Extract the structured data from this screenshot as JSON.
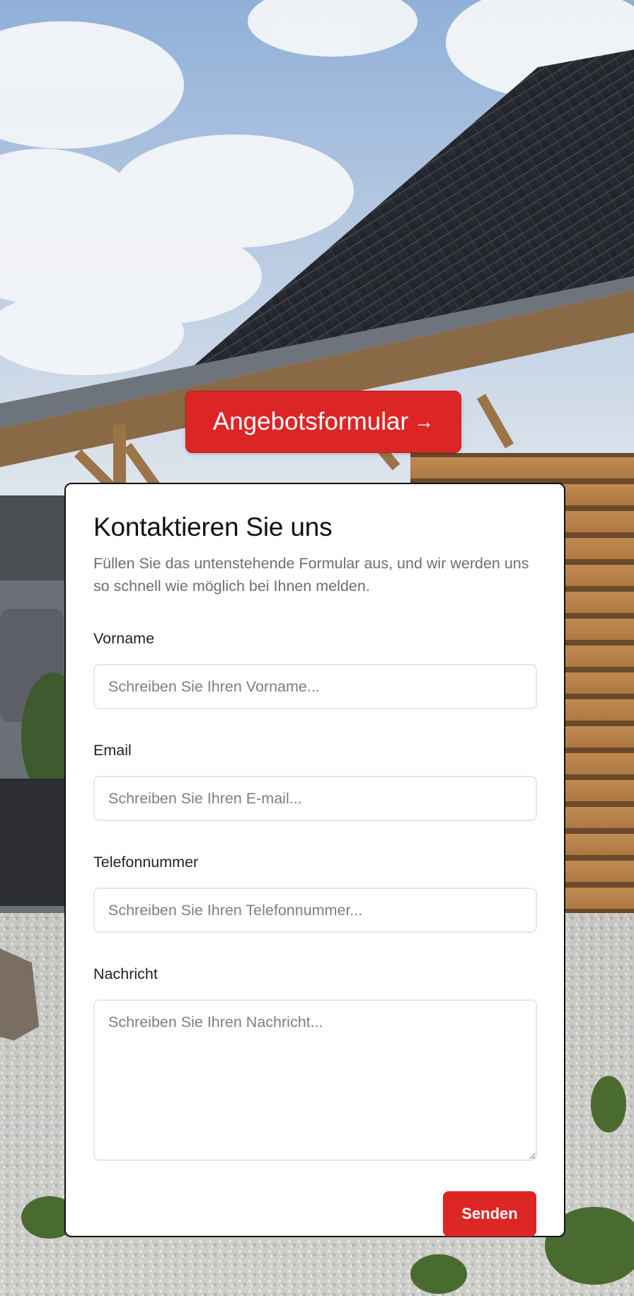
{
  "cta": {
    "label": "Angebotsformular",
    "arrow": "→"
  },
  "form": {
    "title": "Kontaktieren Sie uns",
    "subtitle": "Füllen Sie das untenstehende Formular aus, und wir werden uns so schnell wie möglich bei Ihnen melden.",
    "fields": [
      {
        "label": "Vorname",
        "placeholder": "Schreiben Sie Ihren Vorname...",
        "value": ""
      },
      {
        "label": "Email",
        "placeholder": "Schreiben Sie Ihren E-mail...",
        "value": ""
      },
      {
        "label": "Telefonnummer",
        "placeholder": "Schreiben Sie Ihren Telefonnummer...",
        "value": ""
      },
      {
        "label": "Nachricht",
        "placeholder": "Schreiben Sie Ihren Nachricht...",
        "value": ""
      }
    ],
    "submit_label": "Senden"
  },
  "colors": {
    "accent": "#dc2626",
    "text": "#111111",
    "muted": "#6b6f76",
    "input_border": "#e5e7eb"
  }
}
